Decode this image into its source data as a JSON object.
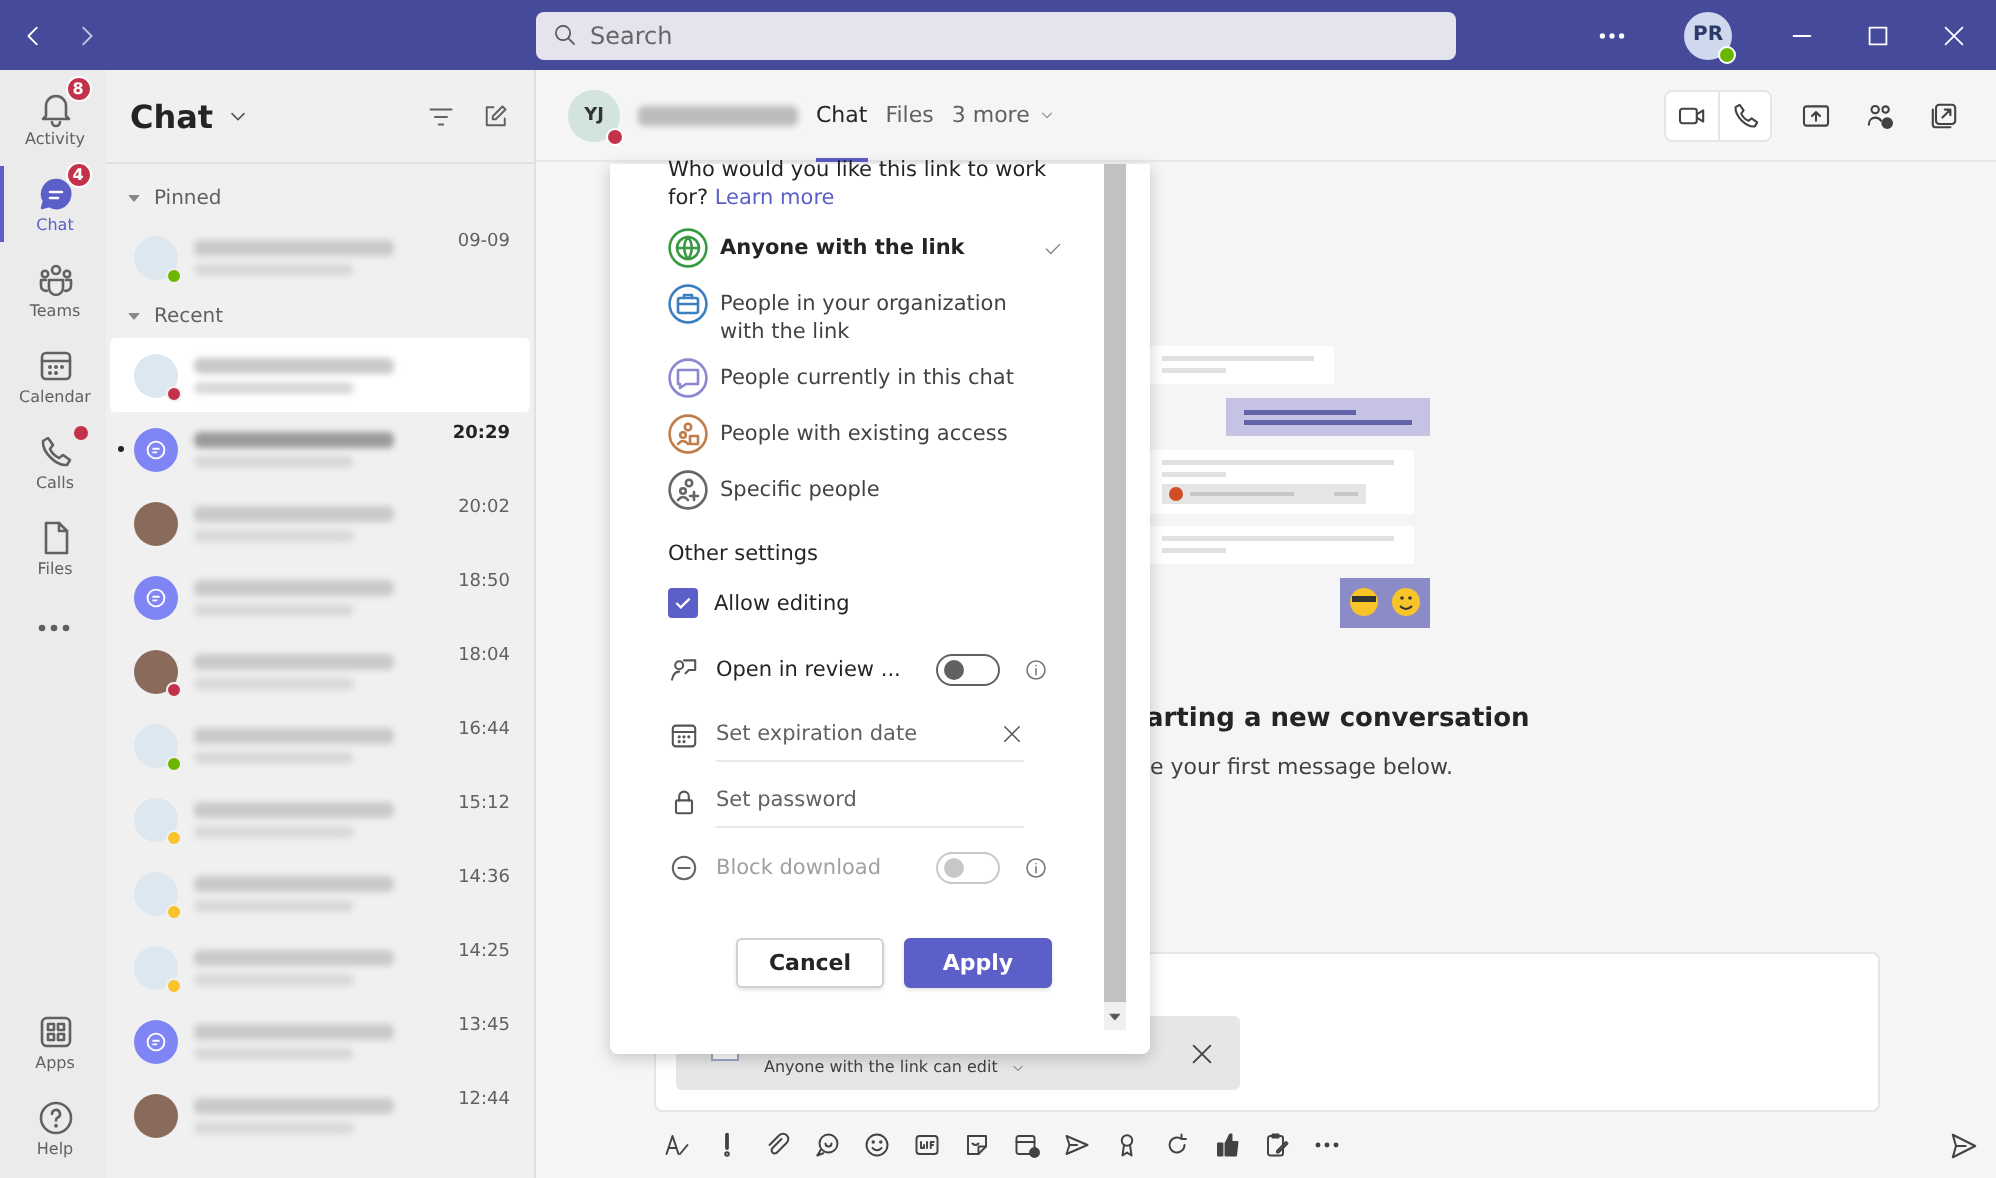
{
  "title_bar": {
    "search": {
      "placeholder": "Search"
    },
    "profile": {
      "initials": "PR",
      "color": "#6bb700"
    }
  },
  "app_bar": {
    "items": [
      {
        "kind": "activity",
        "label": "Activity",
        "badge": "8",
        "selected": false,
        "notification_dot": false
      },
      {
        "kind": "chat",
        "label": "Chat",
        "badge": "4",
        "selected": true,
        "notification_dot": false
      },
      {
        "kind": "teams",
        "label": "Teams",
        "selected": false,
        "notification_dot": false
      },
      {
        "kind": "calendar",
        "label": "Calendar",
        "selected": false,
        "notification_dot": false
      },
      {
        "kind": "calls",
        "label": "Calls",
        "selected": false,
        "notification_dot": true
      },
      {
        "kind": "files",
        "label": "Files",
        "selected": false,
        "notification_dot": false
      }
    ],
    "bottom_items": [
      {
        "kind": "apps",
        "label": "Apps"
      },
      {
        "kind": "help",
        "label": "Help"
      }
    ]
  },
  "chat_list": {
    "title": "Chat",
    "sections": [
      {
        "label": "Pinned",
        "expanded": true,
        "items": [
          {
            "kind": "initials",
            "color": "#6bb700",
            "time": "09-09",
            "selected": false,
            "unread": false
          }
        ]
      },
      {
        "label": "Recent",
        "expanded": true,
        "items": [
          {
            "kind": "initials",
            "color": "#c4314b",
            "selected": true,
            "unread": false
          },
          {
            "kind": "group",
            "time": "20:29",
            "selected": false,
            "unread": true
          },
          {
            "kind": "photo",
            "time": "20:02",
            "selected": false,
            "unread": false
          },
          {
            "kind": "group",
            "time": "18:50",
            "selected": false,
            "unread": false
          },
          {
            "kind": "photo",
            "color": "#c4314b",
            "time": "18:04",
            "selected": false,
            "unread": false
          },
          {
            "kind": "initials",
            "color": "#6bb700",
            "time": "16:44",
            "selected": false,
            "unread": false
          },
          {
            "kind": "initials",
            "color": "#f8c42a",
            "time": "15:12",
            "selected": false,
            "unread": false
          },
          {
            "kind": "initials",
            "color": "#f8c42a",
            "time": "14:36",
            "selected": false,
            "unread": false
          },
          {
            "kind": "initials",
            "color": "#f8c42a",
            "time": "14:25",
            "selected": false,
            "unread": false
          },
          {
            "kind": "group",
            "time": "13:45",
            "selected": false,
            "unread": false
          },
          {
            "kind": "photo",
            "time": "12:44",
            "selected": false,
            "unread": false
          }
        ]
      }
    ]
  },
  "conversation": {
    "avatar": {
      "initials": "YJ",
      "color": "#c4314b"
    },
    "tabs": [
      {
        "label": "Chat",
        "selected": true
      },
      {
        "label": "Files",
        "selected": false
      },
      {
        "label": "3 more",
        "selected": false
      }
    ],
    "empty_state": {
      "title": "arting a new conversation",
      "subtitle": "e your first message below."
    },
    "composer": {
      "attachment": {
        "permission": "Anyone with the link can edit"
      }
    }
  },
  "link_dialog": {
    "prompt": "Who would you like this link to work for?",
    "link": "Learn more",
    "options": [
      {
        "kind": "globe",
        "label": "Anyone with the link",
        "selected": true
      },
      {
        "kind": "organization",
        "label": "People in your organization with the link",
        "selected": false
      },
      {
        "kind": "chat",
        "label": "People currently in this chat",
        "selected": false
      },
      {
        "kind": "existing",
        "label": "People with existing access",
        "selected": false
      },
      {
        "kind": "specific",
        "label": "Specific people",
        "selected": false
      }
    ],
    "other_settings": {
      "heading": "Other settings",
      "settings": [
        {
          "kind": "checkbox",
          "label": "Allow editing",
          "checked": true
        },
        {
          "kind": "review",
          "label": "Open in review ...",
          "on": false,
          "disabled": false
        },
        {
          "kind": "date",
          "placeholder": "Set expiration date",
          "clearable": true
        },
        {
          "kind": "password",
          "placeholder": "Set password",
          "clearable": false
        },
        {
          "kind": "block",
          "label": "Block download",
          "on": false,
          "disabled": true
        }
      ]
    },
    "buttons": [
      {
        "kind": "secondary",
        "label": "Cancel"
      },
      {
        "kind": "primary",
        "label": "Apply"
      }
    ]
  }
}
